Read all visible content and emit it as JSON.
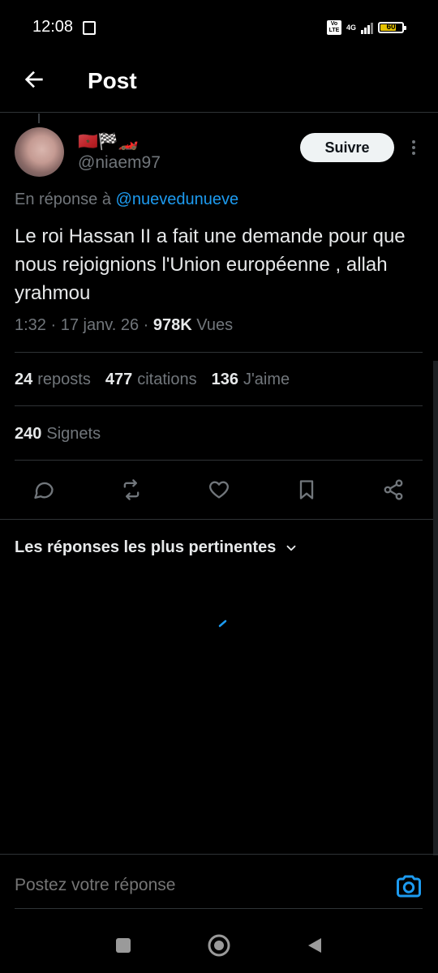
{
  "status_bar": {
    "time": "12:08",
    "network": "4G",
    "volte": "Vo LTE",
    "battery": "60"
  },
  "header": {
    "title": "Post"
  },
  "author": {
    "flags": "🇲🇦🏁🏎️",
    "handle": "@niaem97"
  },
  "follow_label": "Suivre",
  "tweet": {
    "reply_prefix": "En réponse à",
    "reply_mention": "@nuevedunueve",
    "text": "Le roi Hassan II a fait une demande pour que nous rejoignions l'Union européenne , allah yrahmou",
    "time": "1:32",
    "date": "17 janv. 26",
    "views_count": "978K",
    "views_label": "Vues"
  },
  "stats": {
    "reposts_count": "24",
    "reposts_label": "reposts",
    "quotes_count": "477",
    "quotes_label": "citations",
    "likes_count": "136",
    "likes_label": "J'aime",
    "bookmarks_count": "240",
    "bookmarks_label": "Signets"
  },
  "actions": [
    "reply-icon",
    "repost-icon",
    "like-icon",
    "bookmark-icon",
    "share-icon"
  ],
  "sort_label": "Les réponses les plus pertinentes",
  "reply_box": {
    "placeholder": "Postez votre réponse"
  },
  "colors": {
    "accent": "#1d9bf0",
    "background": "#000000",
    "divider": "#2f3336",
    "muted": "#71767b"
  }
}
